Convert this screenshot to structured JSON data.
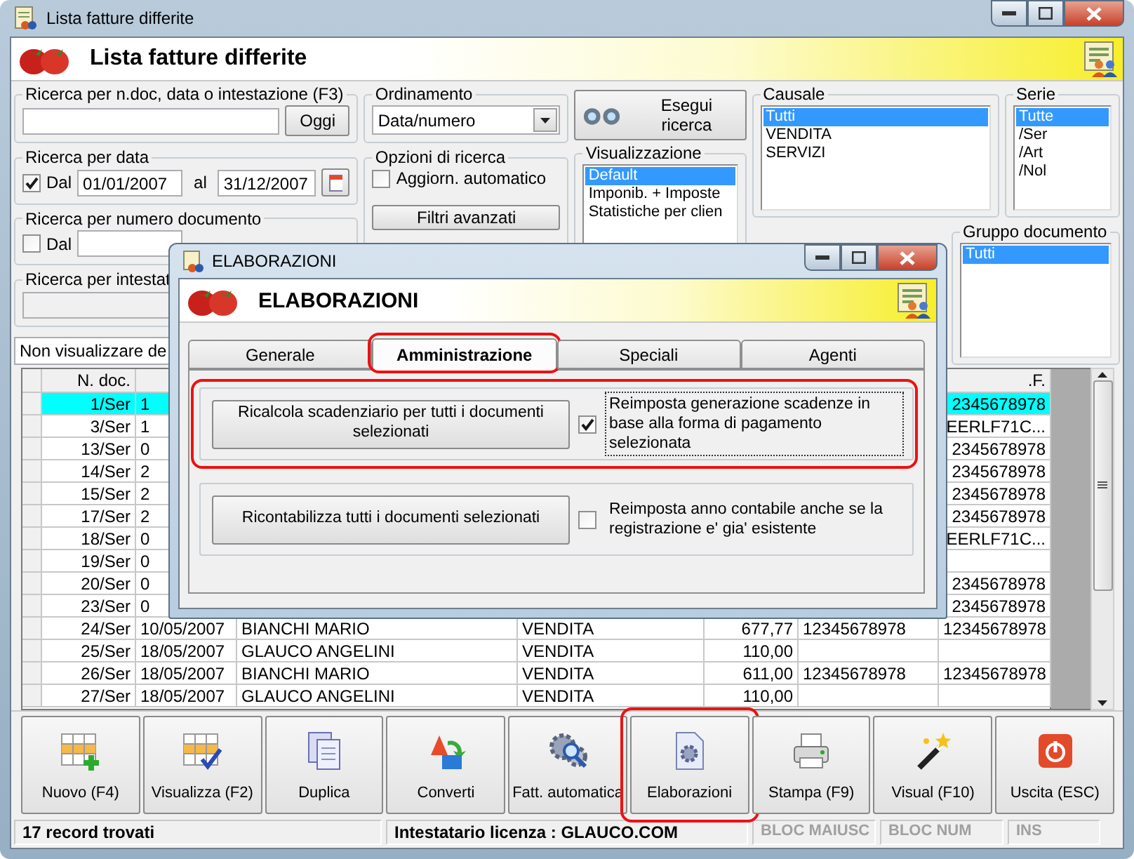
{
  "window": {
    "title": "Lista fatture differite"
  },
  "header": {
    "title": "Lista fatture differite"
  },
  "search_text": {
    "legend": "Ricerca per n.doc, data o intestazione (F3)",
    "button": "Oggi"
  },
  "search_date": {
    "legend": "Ricerca per data",
    "checked": true,
    "from_label": "Dal",
    "from": "01/01/2007",
    "to_label": "al",
    "to": "31/12/2007"
  },
  "search_number": {
    "legend": "Ricerca per numero documento",
    "checked": false,
    "from_label": "Dal"
  },
  "search_holder": {
    "legend": "Ricerca per intestat"
  },
  "filter_select": {
    "value": "Non visualizzare de"
  },
  "sorting": {
    "legend": "Ordinamento",
    "value": "Data/numero"
  },
  "options": {
    "legend": "Opzioni di ricerca",
    "auto_update": {
      "label": "Aggiorn. automatico",
      "checked": false
    },
    "button": "Filtri avanzati"
  },
  "search_button": {
    "label": "Esegui ricerca"
  },
  "view": {
    "legend": "Visualizzazione",
    "items": [
      {
        "label": "Default",
        "selected": true
      },
      {
        "label": "Imponib. + Imposte",
        "selected": false
      },
      {
        "label": "Statistiche per clien",
        "selected": false
      }
    ]
  },
  "causale": {
    "legend": "Causale",
    "items": [
      {
        "label": "Tutti",
        "selected": true
      },
      {
        "label": "VENDITA",
        "selected": false
      },
      {
        "label": "SERVIZI",
        "selected": false
      }
    ]
  },
  "serie": {
    "legend": "Serie",
    "items": [
      {
        "label": "Tutte",
        "selected": true
      },
      {
        "label": "/Ser",
        "selected": false
      },
      {
        "label": "/Art",
        "selected": false
      },
      {
        "label": "/Nol",
        "selected": false
      }
    ]
  },
  "document_group": {
    "legend": "Gruppo documento",
    "items": [
      {
        "label": "Tutti",
        "selected": true
      }
    ]
  },
  "table": {
    "header_n_doc": "N. doc.",
    "header_last": ".F.",
    "rows": [
      {
        "n_doc": "1/Ser",
        "data": "1",
        "cf": "2345678978",
        "selected": true
      },
      {
        "n_doc": "3/Ser",
        "data": "1",
        "cf": "EERLF71C...",
        "selected": false
      },
      {
        "n_doc": "13/Ser",
        "data": "0",
        "cf": "2345678978",
        "selected": false
      },
      {
        "n_doc": "14/Ser",
        "data": "2",
        "cf": "2345678978",
        "selected": false
      },
      {
        "n_doc": "15/Ser",
        "data": "2",
        "cf": "2345678978",
        "selected": false
      },
      {
        "n_doc": "17/Ser",
        "data": "2",
        "cf": "2345678978",
        "selected": false
      },
      {
        "n_doc": "18/Ser",
        "data": "0",
        "cf": "EERLF71C...",
        "selected": false
      },
      {
        "n_doc": "19/Ser",
        "data": "0",
        "selected": false
      },
      {
        "n_doc": "20/Ser",
        "data": "0",
        "cf": "2345678978",
        "selected": false
      },
      {
        "n_doc": "23/Ser",
        "data": "0",
        "cf": "2345678978",
        "selected": false
      },
      {
        "n_doc": "24/Ser",
        "data": "10/05/2007",
        "intestatario": "BIANCHI MARIO",
        "causale": "VENDITA",
        "totale": "677,77",
        "piva": "12345678978",
        "cf": "12345678978",
        "selected": false
      },
      {
        "n_doc": "25/Ser",
        "data": "18/05/2007",
        "intestatario": "GLAUCO ANGELINI",
        "causale": "VENDITA",
        "totale": "110,00",
        "selected": false
      },
      {
        "n_doc": "26/Ser",
        "data": "18/05/2007",
        "intestatario": "BIANCHI MARIO",
        "causale": "VENDITA",
        "totale": "611,00",
        "piva": "12345678978",
        "cf": "12345678978",
        "selected": false
      },
      {
        "n_doc": "27/Ser",
        "data": "18/05/2007",
        "intestatario": "GLAUCO ANGELINI",
        "causale": "VENDITA",
        "totale": "110,00",
        "selected": false
      }
    ]
  },
  "toolbar": [
    {
      "label": "Nuovo (F4)",
      "kind": "grid-plus",
      "highlighted": false
    },
    {
      "label": "Visualizza (F2)",
      "kind": "grid-check",
      "highlighted": false
    },
    {
      "label": "Duplica",
      "kind": "copy",
      "highlighted": false
    },
    {
      "label": "Converti",
      "kind": "convert",
      "highlighted": false
    },
    {
      "label": "Fatt. automatica",
      "kind": "gears",
      "highlighted": false
    },
    {
      "label": "Elaborazioni",
      "kind": "doc-gear",
      "highlighted": true
    },
    {
      "label": "Stampa (F9)",
      "kind": "printer",
      "highlighted": false
    },
    {
      "label": "Visual (F10)",
      "kind": "wand",
      "highlighted": false
    },
    {
      "label": "Uscita (ESC)",
      "kind": "power",
      "highlighted": false
    }
  ],
  "status_bar": {
    "records": "17 record trovati",
    "license": "Intestatario licenza : GLAUCO.COM",
    "indicators": [
      {
        "label": "BLOC MAIUSC",
        "on": false
      },
      {
        "label": "BLOC NUM",
        "on": false
      },
      {
        "label": "INS",
        "on": false
      }
    ]
  },
  "dialog": {
    "title": "ELABORAZIONI",
    "header": "ELABORAZIONI",
    "tabs": [
      {
        "label": "Generale",
        "selected": false,
        "highlighted": false
      },
      {
        "label": "Amministrazione",
        "selected": true,
        "highlighted": true
      },
      {
        "label": "Speciali",
        "selected": false,
        "highlighted": false
      },
      {
        "label": "Agenti",
        "selected": false,
        "highlighted": false
      }
    ],
    "actions": [
      {
        "button": "Ricalcola scadenziario per tutti i documenti selezionati",
        "option": "Reimposta generazione scadenze in base alla forma di pagamento selezionata",
        "checked": true,
        "focused": true,
        "highlighted": true
      },
      {
        "button": "Ricontabilizza tutti i documenti selezionati",
        "option": "Reimposta anno contabile anche se la registrazione e' gia' esistente",
        "checked": false,
        "focused": false,
        "highlighted": false
      }
    ]
  }
}
